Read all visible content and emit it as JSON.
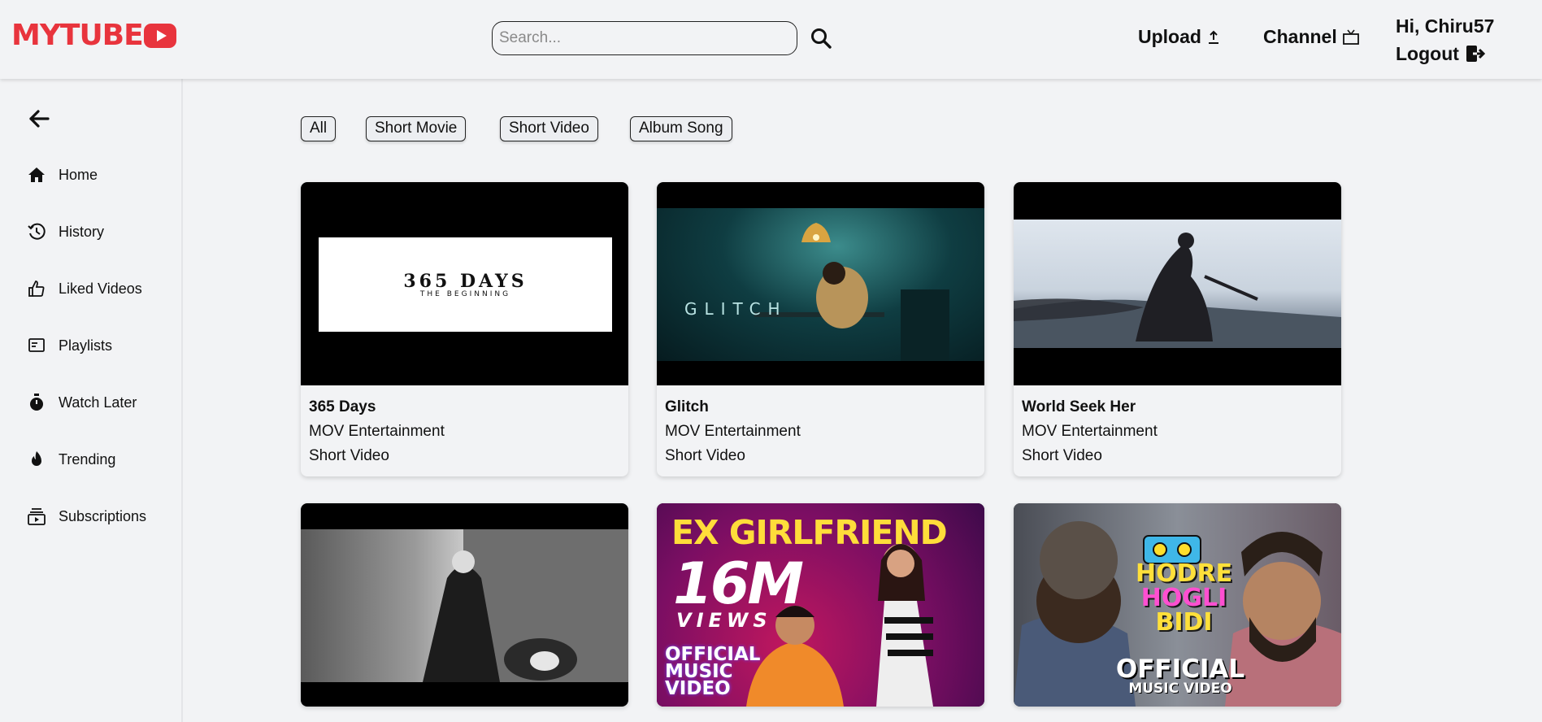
{
  "app": {
    "logo_text": "MYTUBE",
    "logo_icon": "play-button-icon",
    "brand_color": "#e8343d"
  },
  "header": {
    "search": {
      "placeholder": "Search...",
      "value": ""
    },
    "upload_label": "Upload",
    "channel_label": "Channel",
    "greeting": "Hi, Chiru57",
    "logout_label": "Logout"
  },
  "sidebar": {
    "items": [
      {
        "label": "Home",
        "icon": "home-icon"
      },
      {
        "label": "History",
        "icon": "history-icon"
      },
      {
        "label": "Liked Videos",
        "icon": "thumbs-up-icon"
      },
      {
        "label": "Playlists",
        "icon": "playlist-icon"
      },
      {
        "label": "Watch Later",
        "icon": "stopwatch-icon"
      },
      {
        "label": "Trending",
        "icon": "flame-icon"
      },
      {
        "label": "Subscriptions",
        "icon": "subscriptions-icon"
      }
    ]
  },
  "filters": [
    "All",
    "Short Movie",
    "Short Video",
    "Album Song"
  ],
  "videos": [
    {
      "title": "365 Days",
      "channel": "MOV Entertainment",
      "category": "Short Video",
      "thumb_text": {
        "main": "365 DAYS",
        "sub": "THE BEGINNING"
      }
    },
    {
      "title": "Glitch",
      "channel": "MOV Entertainment",
      "category": "Short Video",
      "thumb_text": {
        "main": "GLITCH"
      }
    },
    {
      "title": "World Seek Her",
      "channel": "MOV Entertainment",
      "category": "Short Video"
    },
    {},
    {
      "thumb_text": {
        "headline": "EX GIRLFRIEND",
        "big": "16M",
        "views": "VIEWS",
        "official": "OFFICIAL",
        "music": "MUSIC",
        "video": "VIDEO"
      }
    },
    {
      "thumb_text": {
        "line1": "HODRE",
        "line2": "HOGLI",
        "line3": "BIDI",
        "official": "OFFICIAL",
        "sub": "MUSIC VIDEO"
      }
    }
  ]
}
